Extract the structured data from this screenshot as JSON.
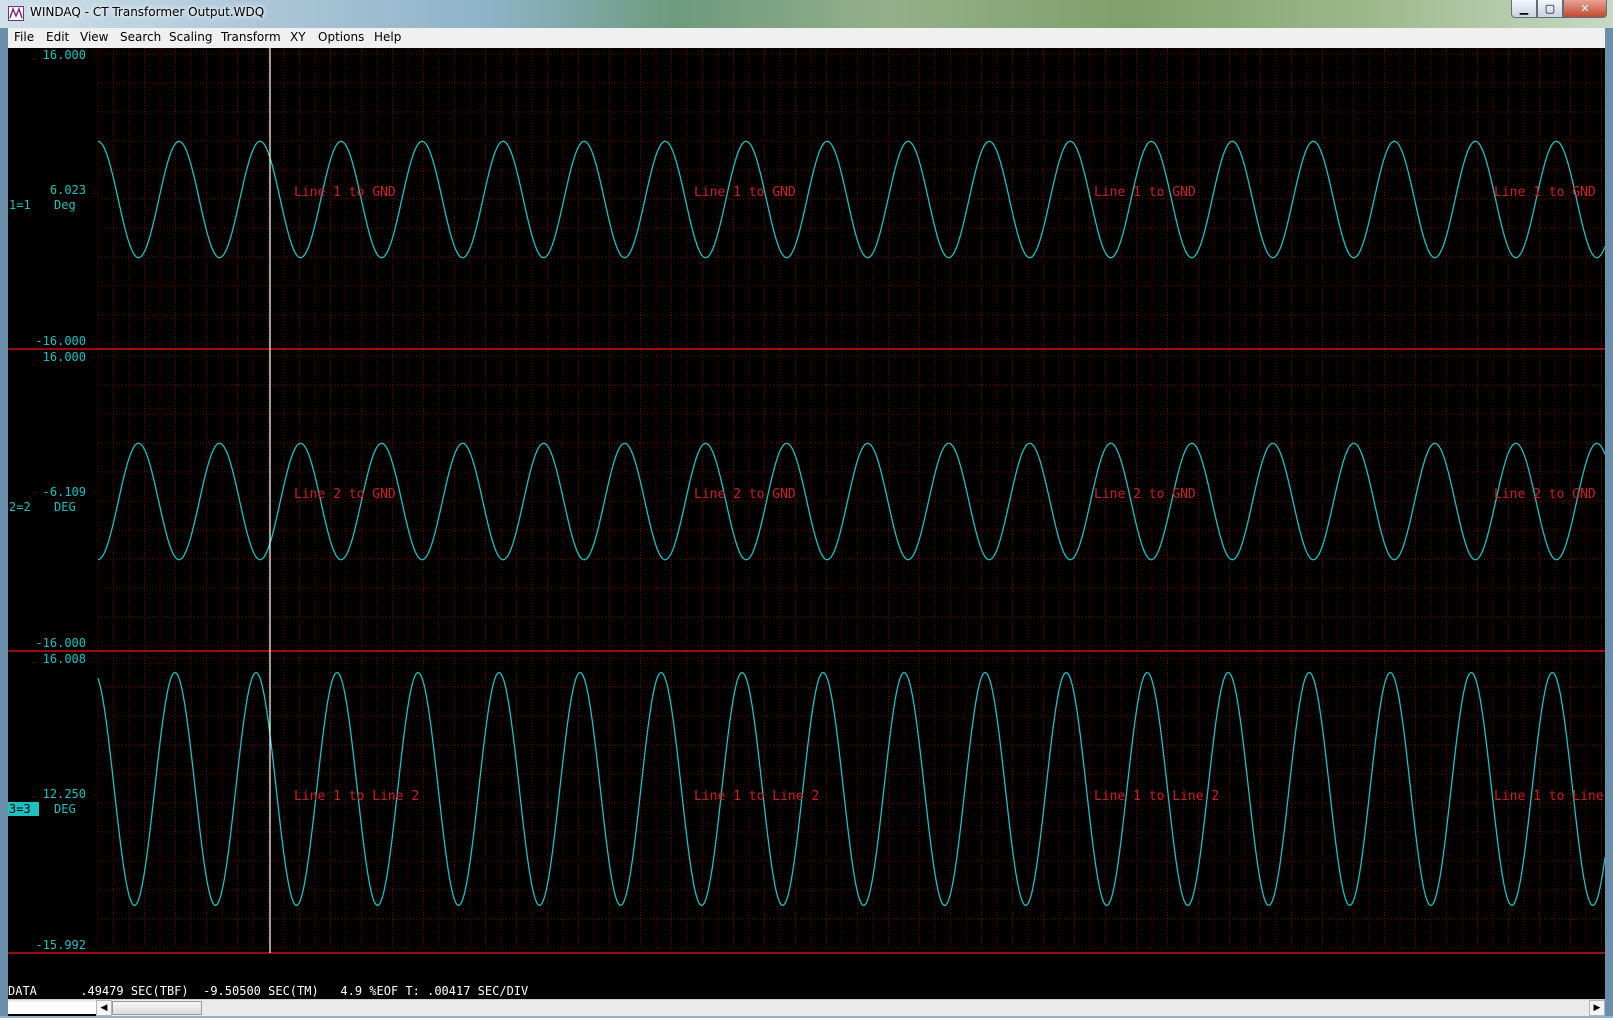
{
  "window": {
    "title": "WINDAQ - CT Transformer Output.WDQ",
    "minimize_glyph": "▁",
    "maximize_glyph": "▢",
    "close_glyph": "✕"
  },
  "menu": [
    "File",
    "Edit",
    "View",
    "Search",
    "Scaling",
    "Transform",
    "XY",
    "Options",
    "Help"
  ],
  "colors": {
    "background": "#000000",
    "grid": "#6a0000",
    "separator": "#d01010",
    "waveform": "#1fc0c0",
    "label_text": "#cc2020",
    "axis_text": "#1fc0c0",
    "cursor": "#ffffff",
    "selected_channel": "#1fc0c0"
  },
  "channels": [
    {
      "id": "1=1",
      "unit": "Deg",
      "top_value": "16.000",
      "mid_value": "6.023",
      "bottom_value": "-16.000",
      "annotation": "Line 1 to GND",
      "selected": false,
      "cycles": 18.6,
      "amplitude_fraction": 0.4,
      "center_fraction": 0.5,
      "phase_cycles": -0.75
    },
    {
      "id": "2=2",
      "unit": "DEG",
      "top_value": "16.000",
      "mid_value": "-6.109",
      "bottom_value": "-16.000",
      "annotation": "Line 2 to GND",
      "selected": false,
      "cycles": 18.6,
      "amplitude_fraction": 0.4,
      "center_fraction": 0.5,
      "phase_cycles": -0.25
    },
    {
      "id": "3=3",
      "unit": "DEG",
      "top_value": "16.008",
      "mid_value": "12.250",
      "bottom_value": "-15.992",
      "annotation": "Line 1 to Line 2",
      "selected": true,
      "cycles": 18.6,
      "amplitude_fraction": 0.8,
      "center_fraction": 0.45,
      "phase_cycles": -0.7
    }
  ],
  "status": {
    "mode": "DATA",
    "tbf": ".49479 SEC(TBF)",
    "tm": "-9.50500 SEC(TM)",
    "eof": "4.9 %EOF",
    "t_label": "T:",
    "sec_div": ".00417 SEC/DIV"
  },
  "scroll": {
    "left_arrow": "◀",
    "right_arrow": "▶"
  }
}
